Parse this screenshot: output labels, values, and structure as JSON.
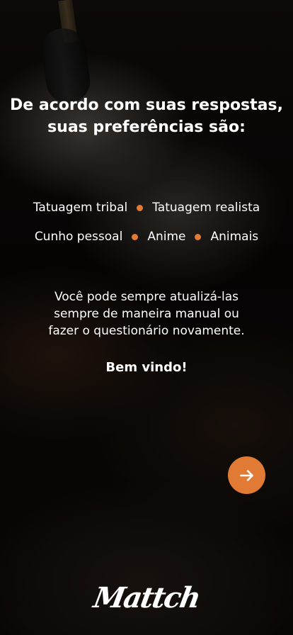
{
  "title": "De acordo com suas respostas, suas preferências são:",
  "preferences": {
    "row1": [
      "Tatuagem tribal",
      "Tatuagem realista"
    ],
    "row2": [
      "Cunho pessoal",
      "Anime",
      "Animais"
    ]
  },
  "info_lines": [
    "Você pode sempre atualizá-las",
    "sempre de maneira manual ou",
    "fazer o questionário novamente."
  ],
  "welcome": "Bem vindo!",
  "next_button_icon": "arrow-right-icon",
  "logo": "Mattch",
  "colors": {
    "accent": "#e07a34",
    "text": "#ffffff"
  }
}
